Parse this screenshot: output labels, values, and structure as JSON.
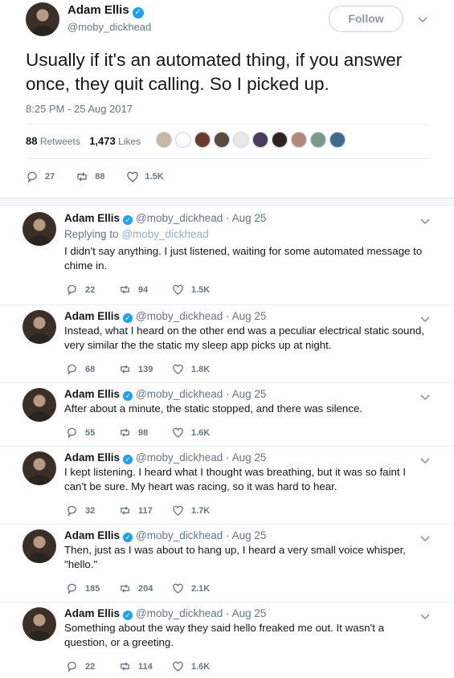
{
  "main_tweet": {
    "author_name": "Adam Ellis",
    "verified_mark": "✓",
    "handle": "@moby_dickhead",
    "follow_label": "Follow",
    "text": "Usually if it's an automated thing, if you answer once, they quit calling. So I picked up.",
    "timestamp": "8:25 PM - 25 Aug 2017",
    "retweets_count": "88",
    "retweets_label": "Retweets",
    "likes_count": "1,473",
    "likes_label": "Likes",
    "liker_colors": [
      "#c9b7a6",
      "#ffffff",
      "#6b3a2a",
      "#5a4a3f",
      "#e8e8e8",
      "#4a3b5c",
      "#2e2220",
      "#b08a7a",
      "#7a9b8c",
      "#3d6a8f"
    ],
    "replies": "27",
    "retweets": "88",
    "likes": "1.5K"
  },
  "replies": [
    {
      "name": "Adam Ellis",
      "handle": "@moby_dickhead",
      "date": "· Aug 25",
      "replying_label": "Replying to",
      "replying_handle": "@moby_dickhead",
      "text": "I didn't say anything. I just listened, waiting for some automated message to chime in.",
      "replies": "22",
      "retweets": "94",
      "likes": "1.5K"
    },
    {
      "name": "Adam Ellis",
      "handle": "@moby_dickhead",
      "date": "· Aug 25",
      "text": "Instead, what I heard on the other end was a peculiar electrical static sound, very similar the the static my sleep app picks up at night.",
      "replies": "68",
      "retweets": "139",
      "likes": "1.8K"
    },
    {
      "name": "Adam Ellis",
      "handle": "@moby_dickhead",
      "date": "· Aug 25",
      "text": "After about a minute, the static stopped, and there was silence.",
      "replies": "55",
      "retweets": "98",
      "likes": "1.6K"
    },
    {
      "name": "Adam Ellis",
      "handle": "@moby_dickhead",
      "date": "· Aug 25",
      "text": "I kept listening. I heard what I thought was breathing, but it was so faint I can't be sure. My heart was racing, so it was hard to hear.",
      "replies": "32",
      "retweets": "117",
      "likes": "1.7K"
    },
    {
      "name": "Adam Ellis",
      "handle": "@moby_dickhead",
      "date": "· Aug 25",
      "text": "Then, just as I was about to hang up, I heard a very small voice whisper, \"hello.\"",
      "replies": "185",
      "retweets": "204",
      "likes": "2.1K"
    },
    {
      "name": "Adam Ellis",
      "handle": "@moby_dickhead",
      "date": "· Aug 25",
      "text": "Something about the way they said hello freaked me out. It wasn't a question, or a greeting.",
      "replies": "22",
      "retweets": "114",
      "likes": "1.6K"
    }
  ]
}
